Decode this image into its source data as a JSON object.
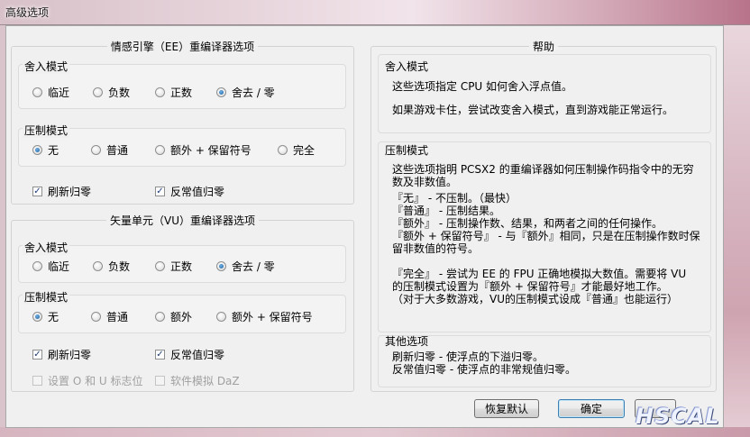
{
  "window": {
    "title": "高级选项"
  },
  "ee": {
    "title": "情感引擎（EE）重编译器选项",
    "round": {
      "label": "舍入模式",
      "options": [
        "临近",
        "负数",
        "正数",
        "舍去 / 零"
      ],
      "selected_index": 3
    },
    "clamp": {
      "label": "压制模式",
      "options": [
        "无",
        "普通",
        "额外 + 保留符号",
        "完全"
      ],
      "selected_index": 0
    },
    "checks": [
      {
        "label": "刷新归零",
        "checked": true
      },
      {
        "label": "反常值归零",
        "checked": true
      }
    ]
  },
  "vu": {
    "title": "矢量单元（VU）重编译器选项",
    "round": {
      "label": "舍入模式",
      "options": [
        "临近",
        "负数",
        "正数",
        "舍去 / 零"
      ],
      "selected_index": 3
    },
    "clamp": {
      "label": "压制模式",
      "options": [
        "无",
        "普通",
        "额外",
        "额外 + 保留符号"
      ],
      "selected_index": 0
    },
    "checks": [
      {
        "label": "刷新归零",
        "checked": true
      },
      {
        "label": "反常值归零",
        "checked": true
      }
    ],
    "disabled_checks": [
      {
        "label": "设置 O 和 U 标志位",
        "checked": false
      },
      {
        "label": "软件模拟 DaZ",
        "checked": false
      }
    ]
  },
  "help": {
    "title": "帮助",
    "round": {
      "label": "舍入模式",
      "line1": "这些选项指定 CPU 如何舍入浮点值。",
      "line2": "如果游戏卡住，尝试改变舍入模式，直到游戏能正常运行。"
    },
    "clamp": {
      "label": "压制模式",
      "intro1": "这些选项指明 PCSX2 的重编译器如何压制操作码指令中的无穷",
      "intro2": "数及非数值。",
      "l1": "『无』   - 不压制。（最快）",
      "l2": "『普通』 - 压制结果。",
      "l3": "『额外』 - 压制操作数、结果，和两者之间的任何操作。",
      "l4": "『额外 + 保留符号』 - 与『额外』相同，只是在压制操作数时保",
      "l5": "留非数值的符号。",
      "l6": "『完全』 - 尝试为 EE 的 FPU 正确地模拟大数值。需要将 VU",
      "l7": "的压制模式设置为『额外 + 保留符号』才能最好地工作。",
      "l8": "（对于大多数游戏，VU的压制模式设成『普通』也能运行）"
    },
    "other": {
      "label": "其他选项",
      "l1": "刷新归零 - 使浮点的下溢归零。",
      "l2": "反常值归零 - 使浮点的非常规值归零。"
    }
  },
  "buttons": {
    "restore": "恢复默认",
    "ok": "确定"
  },
  "decor": {
    "logo": "HSCAL"
  }
}
